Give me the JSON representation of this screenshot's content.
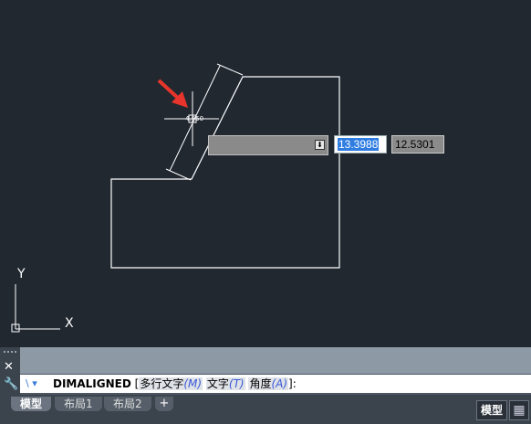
{
  "drawing": {
    "dim_value_text": "4.650",
    "ucs_y_label": "Y",
    "ucs_x_label": "X"
  },
  "dynamic_input": {
    "first_value": "13.3988",
    "second_value": "12.5301",
    "dropdown_arrow": "⬇"
  },
  "command_line": {
    "prefix_icon": "\\ ▾",
    "command": "DIMALIGNED",
    "open_bracket": "[",
    "options": [
      {
        "label": "多行文字",
        "key": "(M)"
      },
      {
        "label": "文字",
        "key": "(T)"
      },
      {
        "label": "角度",
        "key": "(A)"
      }
    ],
    "close": "]:",
    "close_icon": "✕",
    "settings_icon": "🔧"
  },
  "tabs": {
    "items": [
      "模型",
      "布局1",
      "布局2"
    ],
    "add_label": "+"
  },
  "status": {
    "model_label": "模型",
    "grid_icon": "▦"
  },
  "colors": {
    "background": "#212830",
    "geometry": "#ffffff",
    "arrow": "#e8352b",
    "highlight": "#2f7de1"
  }
}
